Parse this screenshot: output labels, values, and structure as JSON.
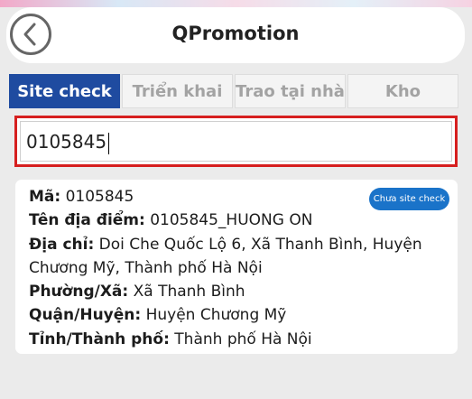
{
  "header": {
    "title": "QPromotion",
    "back_icon": "chevron-left-icon"
  },
  "tabs": [
    {
      "label": "Site check",
      "active": true
    },
    {
      "label": "Triển khai",
      "active": false
    },
    {
      "label": "Trao tại nhà",
      "active": false
    },
    {
      "label": "Kho",
      "active": false
    }
  ],
  "search": {
    "value": "0105845"
  },
  "result": {
    "status": "Chưa site check",
    "fields": [
      {
        "label": "Mã:",
        "value": " 0105845"
      },
      {
        "label": "Tên địa điểm:",
        "value": " 0105845_HUONG ON"
      },
      {
        "label": "Địa chỉ:",
        "value": " Doi Che Quốc Lộ 6, Xã Thanh Bình, Huyện Chương Mỹ, Thành phố Hà Nội"
      },
      {
        "label": "Phường/Xã:",
        "value": " Xã Thanh Bình"
      },
      {
        "label": "Quận/Huyện:",
        "value": " Huyện Chương Mỹ"
      },
      {
        "label": "Tỉnh/Thành phố:",
        "value": " Thành phố Hà Nội"
      }
    ]
  },
  "colors": {
    "accent": "#1f4ba0",
    "badge": "#1a73c9",
    "highlight_border": "#d61f1f"
  }
}
